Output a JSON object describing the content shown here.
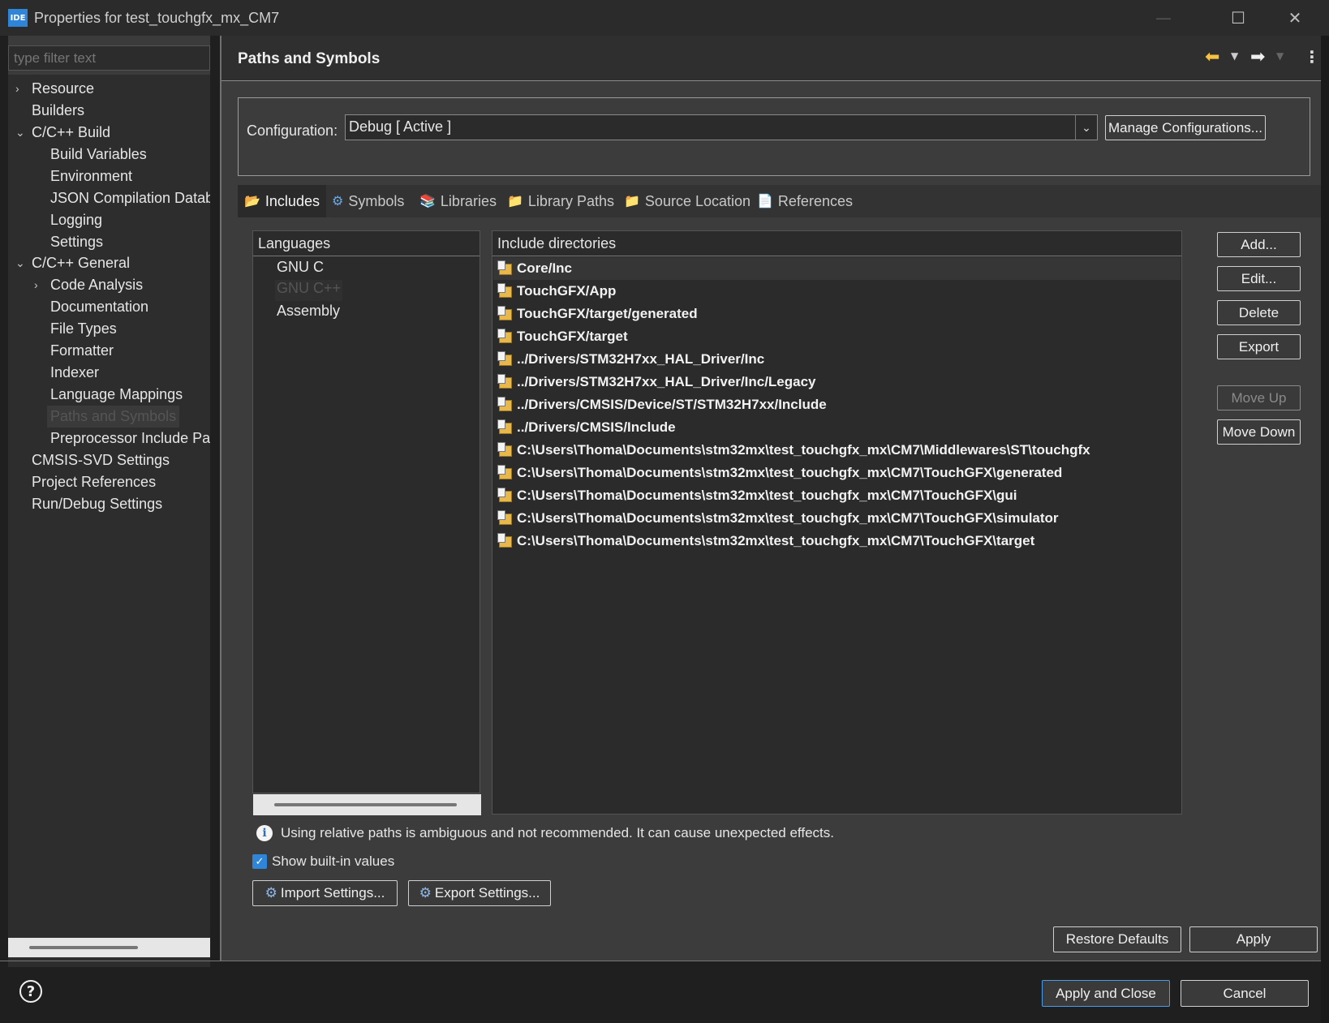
{
  "window": {
    "app_icon": "IDE",
    "title": "Properties for test_touchgfx_mx_CM7",
    "minimize": "—",
    "maximize": "☐",
    "close": "✕"
  },
  "left": {
    "filter_placeholder": "type filter text",
    "tree": [
      {
        "label": "Resource",
        "arrow": "›"
      },
      {
        "label": "Builders"
      },
      {
        "label": "C/C++ Build",
        "arrow": "⌄"
      },
      {
        "label": "Build Variables"
      },
      {
        "label": "Environment"
      },
      {
        "label": "JSON Compilation Datab"
      },
      {
        "label": "Logging"
      },
      {
        "label": "Settings"
      },
      {
        "label": "C/C++ General",
        "arrow": "⌄"
      },
      {
        "label": "Code Analysis",
        "arrow": "›"
      },
      {
        "label": "Documentation"
      },
      {
        "label": "File Types"
      },
      {
        "label": "Formatter"
      },
      {
        "label": "Indexer"
      },
      {
        "label": "Language Mappings"
      },
      {
        "label": "Paths and Symbols",
        "selected": true
      },
      {
        "label": "Preprocessor Include Pat"
      },
      {
        "label": "CMSIS-SVD Settings"
      },
      {
        "label": "Project References"
      },
      {
        "label": "Run/Debug Settings"
      }
    ]
  },
  "header": {
    "title": "Paths and Symbols",
    "back_icon": "back-arrow-icon",
    "forward_icon": "forward-arrow-icon"
  },
  "config": {
    "label": "Configuration:",
    "value": "Debug  [ Active ]",
    "manage_label": "Manage Configurations..."
  },
  "tabs": [
    {
      "label": "Includes",
      "active": true
    },
    {
      "label": "Symbols"
    },
    {
      "label": "Libraries"
    },
    {
      "label": "Library Paths"
    },
    {
      "label": "Source Location"
    },
    {
      "label": "References"
    }
  ],
  "languages": {
    "header": "Languages",
    "items": [
      "GNU C",
      "GNU C++",
      "Assembly"
    ],
    "selected": "GNU C++"
  },
  "includes": {
    "header": "Include directories",
    "items": [
      "Core/Inc",
      "TouchGFX/App",
      "TouchGFX/target/generated",
      "TouchGFX/target",
      "../Drivers/STM32H7xx_HAL_Driver/Inc",
      "../Drivers/STM32H7xx_HAL_Driver/Inc/Legacy",
      "../Drivers/CMSIS/Device/ST/STM32H7xx/Include",
      "../Drivers/CMSIS/Include",
      "C:\\Users\\Thoma\\Documents\\stm32mx\\test_touchgfx_mx\\CM7\\Middlewares\\ST\\touchgfx",
      "C:\\Users\\Thoma\\Documents\\stm32mx\\test_touchgfx_mx\\CM7\\TouchGFX\\generated",
      "C:\\Users\\Thoma\\Documents\\stm32mx\\test_touchgfx_mx\\CM7\\TouchGFX\\gui",
      "C:\\Users\\Thoma\\Documents\\stm32mx\\test_touchgfx_mx\\CM7\\TouchGFX\\simulator",
      "C:\\Users\\Thoma\\Documents\\stm32mx\\test_touchgfx_mx\\CM7\\TouchGFX\\target"
    ]
  },
  "side_buttons": {
    "add": "Add...",
    "edit": "Edit...",
    "delete": "Delete",
    "export": "Export",
    "move_up": "Move Up",
    "move_down": "Move Down"
  },
  "info": {
    "text": "Using relative paths is ambiguous and not recommended. It can cause unexpected effects."
  },
  "show_builtin": {
    "label": "Show built-in values",
    "checked": true
  },
  "settings_buttons": {
    "import": "Import Settings...",
    "export": "Export Settings..."
  },
  "footer": {
    "restore_defaults": "Restore Defaults",
    "apply": "Apply",
    "apply_close": "Apply and Close",
    "cancel": "Cancel"
  }
}
